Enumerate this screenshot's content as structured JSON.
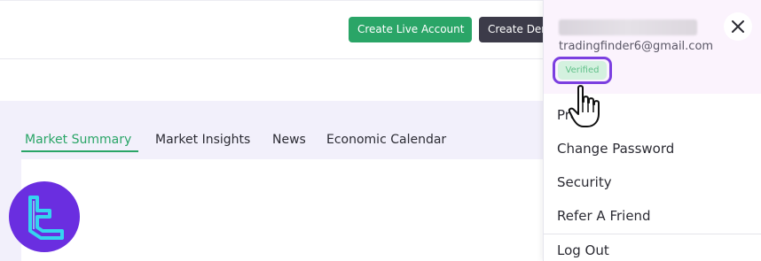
{
  "header": {
    "live_account_label": "Create Live Account",
    "demo_account_label": "Create Demo Account"
  },
  "tabs": [
    {
      "label": "Market Summary",
      "active": true
    },
    {
      "label": "Market Insights",
      "active": false
    },
    {
      "label": "News",
      "active": false
    },
    {
      "label": "Economic Calendar",
      "active": false
    }
  ],
  "account_menu": {
    "email": "tradingfinder6@gmail.com",
    "verified_label": "Verified",
    "items": [
      {
        "label": "Profile"
      },
      {
        "label": "Change Password"
      },
      {
        "label": "Security"
      },
      {
        "label": "Refer A Friend"
      },
      {
        "label": "Log Out"
      }
    ]
  },
  "colors": {
    "accent_green": "#2aa567",
    "highlight_purple": "#7b3fe0",
    "logo_purple": "#6a2ee0",
    "logo_cyan": "#35d4f0"
  },
  "icons": {
    "close": "close-icon",
    "cursor": "hand-pointer-icon",
    "logo": "tradingfinder-logo"
  }
}
